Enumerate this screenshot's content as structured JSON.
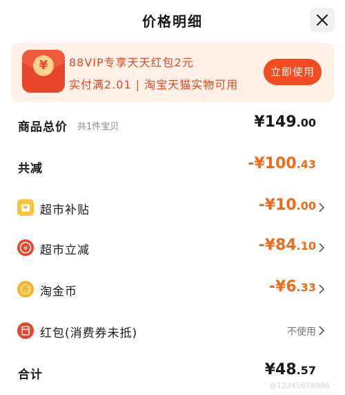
{
  "header": {
    "title": "价格明细"
  },
  "banner": {
    "line1": "88VIP专享天天红包2元",
    "line2": "实付满2.01 | 淘宝天猫实物可用",
    "button_label": "立即使用",
    "icon_symbol": "¥"
  },
  "rows": {
    "total_goods": {
      "label": "商品总价",
      "sub": "共1件宝贝",
      "amount_main": "¥149",
      "amount_dec": ".00"
    },
    "total_reduce": {
      "label": "共减",
      "amount_main": "-¥100",
      "amount_dec": ".43"
    },
    "supermarket_subsidy": {
      "label": "超市补贴",
      "amount_main": "-¥10",
      "amount_dec": ".00"
    },
    "supermarket_instant": {
      "label": "超市立减",
      "amount_main": "-¥84",
      "amount_dec": ".10"
    },
    "taojinbi": {
      "label": "淘金币",
      "amount_main": "-¥6",
      "amount_dec": ".33"
    },
    "red_packet": {
      "label": "红包(消费券未抵)",
      "value": "不使用"
    },
    "total": {
      "label": "合计",
      "amount_main": "¥48",
      "amount_dec": ".57"
    }
  },
  "watermark": "@12345678986",
  "colors": {
    "accent": "#f06a1c",
    "button": "#f34a1f",
    "banner_bg": "#fff0e8",
    "red": "#e8452d",
    "yellow": "#f7c43a"
  }
}
